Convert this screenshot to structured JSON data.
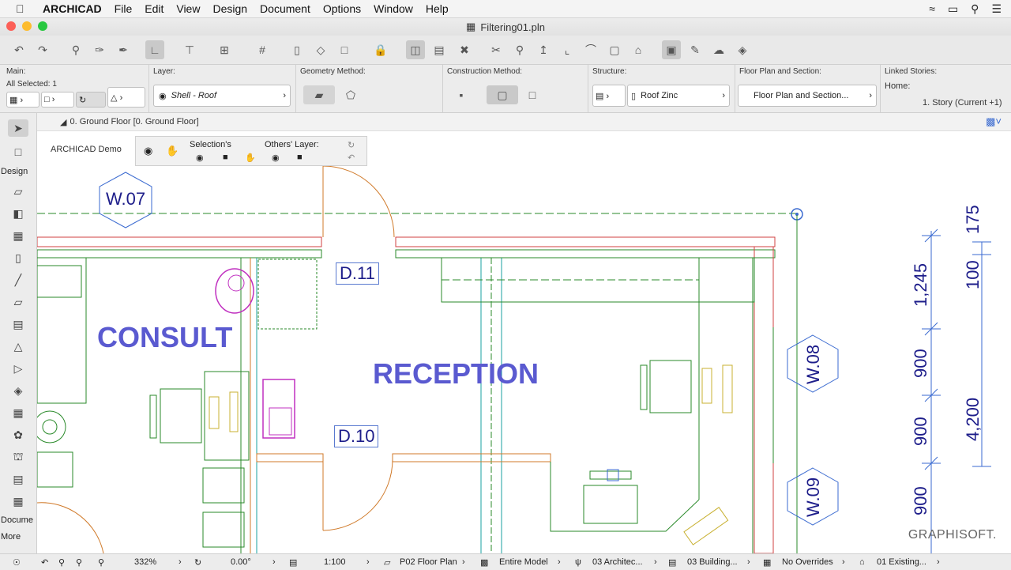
{
  "menubar": {
    "apple": "",
    "app": "ARCHICAD",
    "items": [
      "File",
      "Edit",
      "View",
      "Design",
      "Document",
      "Options",
      "Window",
      "Help"
    ]
  },
  "window": {
    "title": "Filtering01.pln"
  },
  "infobox": {
    "main_label": "Main:",
    "all_selected": "All Selected: 1",
    "layer_label": "Layer:",
    "layer_value": "Shell - Roof",
    "geometry_label": "Geometry Method:",
    "construction_label": "Construction Method:",
    "structure_label": "Structure:",
    "structure_value": "Roof Zinc",
    "floorplan_label": "Floor Plan and Section:",
    "floorplan_value": "Floor Plan and Section...",
    "linked_label": "Linked Stories:",
    "home_label": "Home:",
    "home_value": "1. Story (Current +1)"
  },
  "tab": {
    "label": "0. Ground Floor [0. Ground Floor]"
  },
  "toolbox": {
    "design_label": "Design",
    "document_label": "Docume",
    "more_label": "More"
  },
  "quick_options": {
    "demo_label": "ARCHICAD Demo",
    "selections_label": "Selection's",
    "others_label": "Others' Layer:"
  },
  "drawing": {
    "rooms": [
      "CONSULT",
      "RECEPTION"
    ],
    "doors": [
      "D.11",
      "D.10"
    ],
    "windows": [
      "W.07",
      "W.08",
      "W.09"
    ],
    "dimensions_left": [
      "1,245",
      "900",
      "900",
      "900"
    ],
    "dimensions_right": [
      "175",
      "100",
      "4,200"
    ],
    "watermark": "GRAPHISOFT."
  },
  "statusbar": {
    "zoom": "332%",
    "angle": "0.00°",
    "scale": "1:100",
    "view": "P02 Floor Plan",
    "model": "Entire Model",
    "layer_combo": "03 Architec...",
    "pen_set": "03 Building...",
    "overrides": "No Overrides",
    "renovation": "01 Existing..."
  },
  "colors": {
    "label_blue": "#5a5ad0",
    "tag_blue": "#1d1d8a",
    "wall_green": "#2a8a2a",
    "door_orange": "#d07a2a",
    "furniture_magenta": "#c030c0"
  }
}
